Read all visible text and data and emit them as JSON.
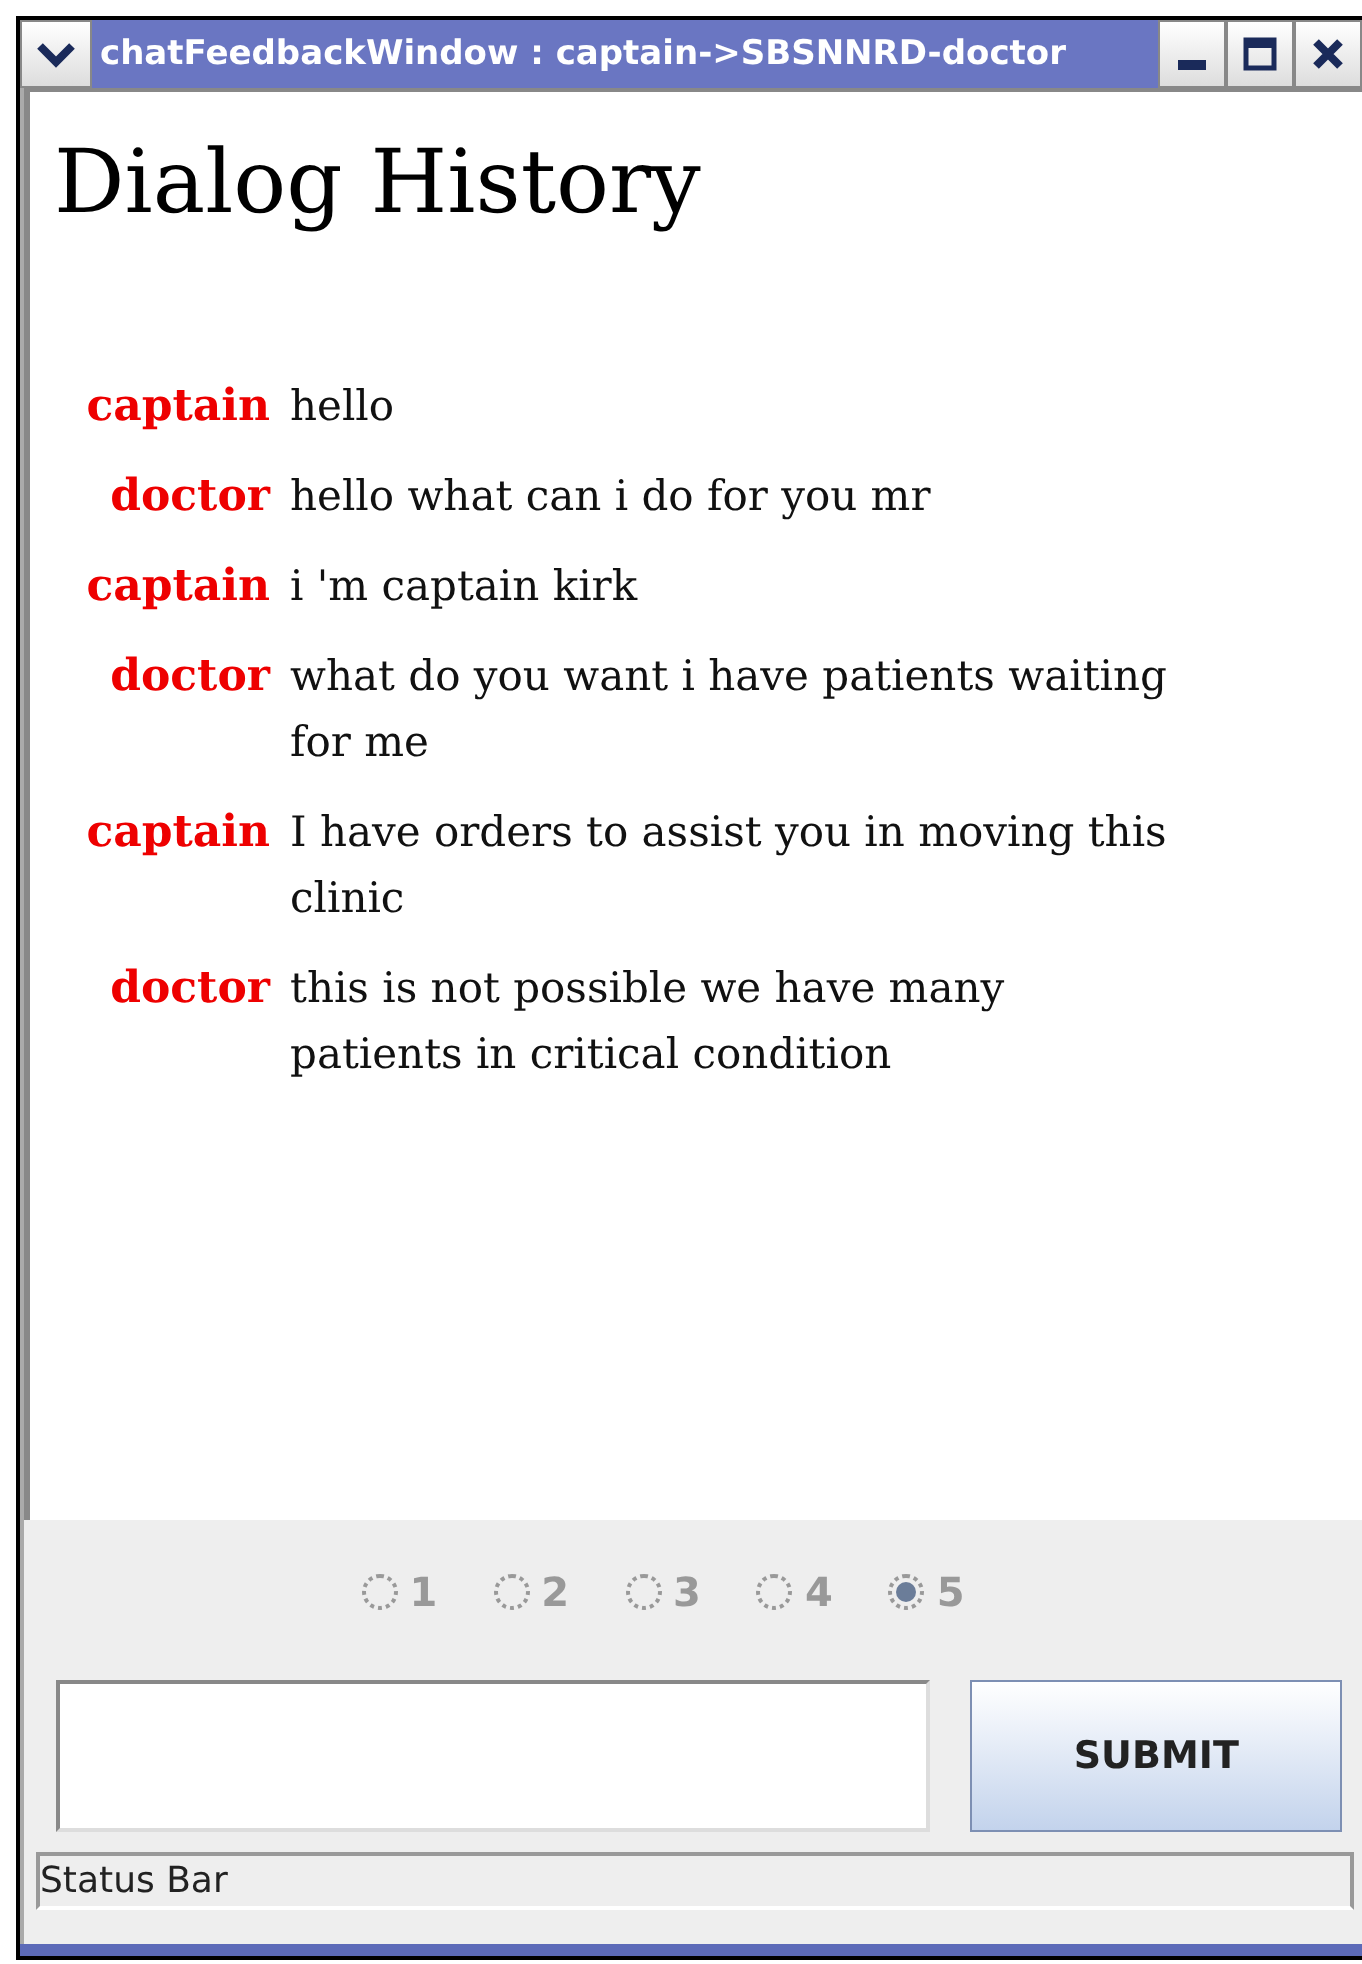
{
  "window": {
    "title": "chatFeedbackWindow : captain->SBSNNRD-doctor"
  },
  "heading": "Dialog History",
  "messages": [
    {
      "speaker": "captain",
      "text": "hello"
    },
    {
      "speaker": "doctor",
      "text": "hello what can i do for you mr"
    },
    {
      "speaker": "captain",
      "text": "i 'm captain kirk"
    },
    {
      "speaker": "doctor",
      "text": "what do you want i have patients waiting for me"
    },
    {
      "speaker": "captain",
      "text": "I have orders to assist you in moving this clinic"
    },
    {
      "speaker": "doctor",
      "text": "this is not possible we have many patients in critical condition"
    }
  ],
  "rating": [
    {
      "label": "1",
      "selected": false
    },
    {
      "label": "2",
      "selected": false
    },
    {
      "label": "3",
      "selected": false
    },
    {
      "label": "4",
      "selected": false
    },
    {
      "label": "5",
      "selected": true
    }
  ],
  "submit_button": "SUBMIT",
  "status_bar": "Status Bar"
}
